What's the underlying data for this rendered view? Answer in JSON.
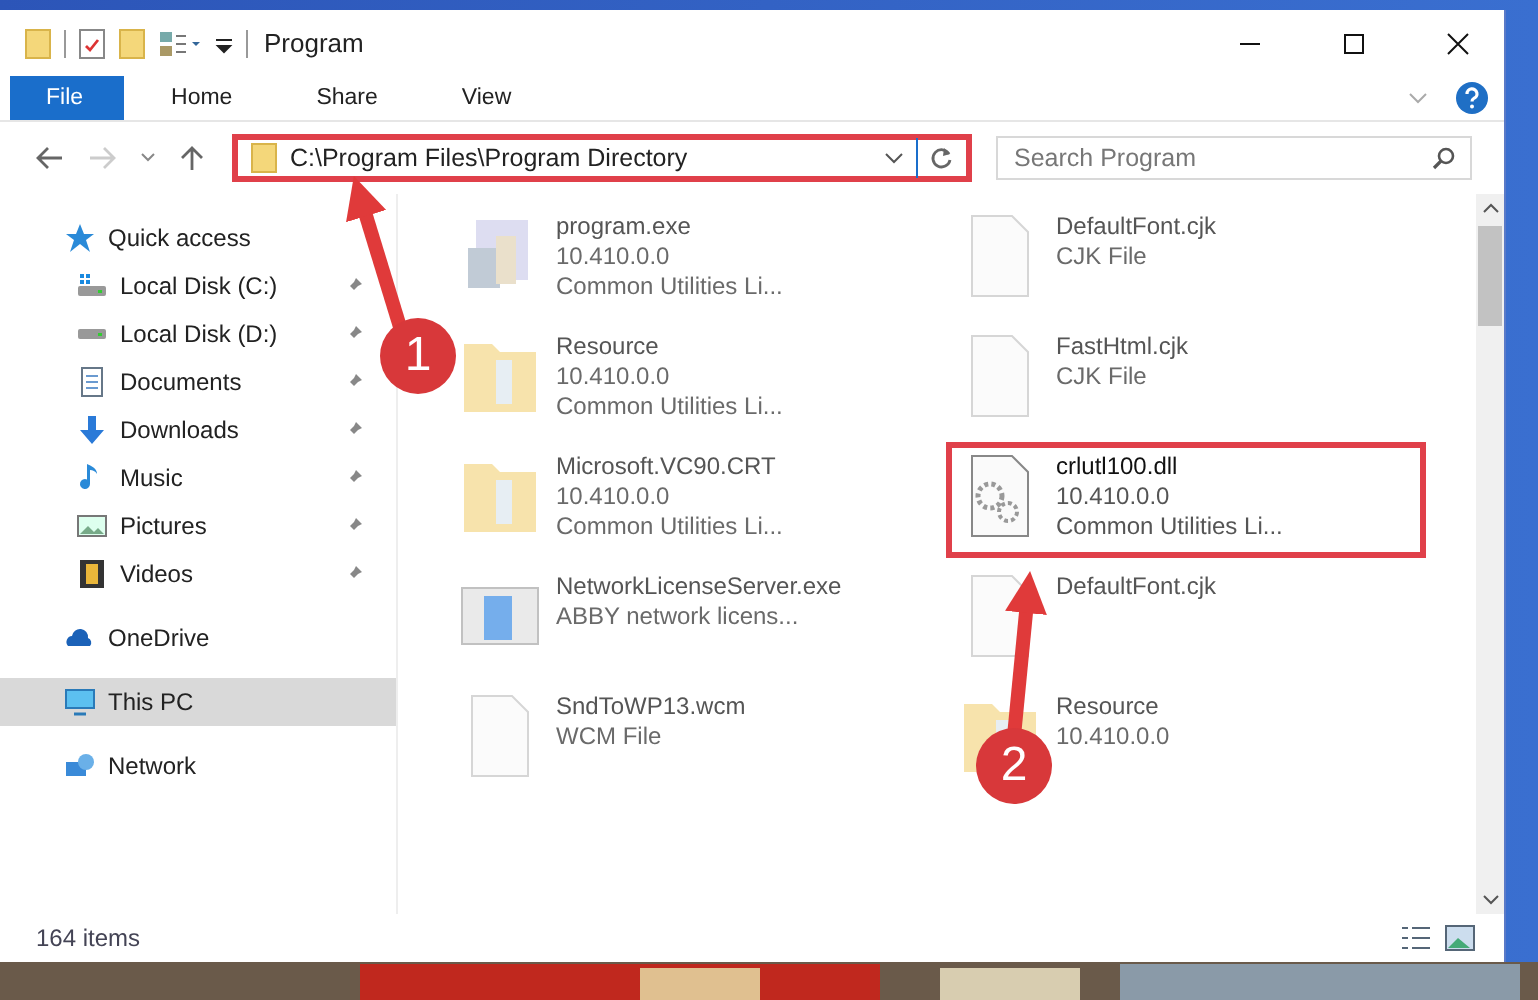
{
  "window": {
    "title": "Program"
  },
  "ribbon_tabs": [
    {
      "label": "File",
      "selected": true
    },
    {
      "label": "Home",
      "selected": false
    },
    {
      "label": "Share",
      "selected": false
    },
    {
      "label": "View",
      "selected": false
    }
  ],
  "address": {
    "path": "C:\\Program Files\\Program Directory",
    "highlighted": true
  },
  "search": {
    "placeholder": "Search Program"
  },
  "sidebar": {
    "items": [
      {
        "label": "Quick access",
        "kind": "star",
        "selected": false,
        "children": [
          {
            "label": "Local Disk (C:)",
            "kind": "disk-c",
            "selected": false,
            "pinned": true
          },
          {
            "label": "Local Disk (D:)",
            "kind": "disk",
            "selected": false,
            "pinned": true
          },
          {
            "label": "Documents",
            "kind": "documents",
            "selected": false,
            "pinned": true
          },
          {
            "label": "Downloads",
            "kind": "downloads",
            "selected": false,
            "pinned": true
          },
          {
            "label": "Music",
            "kind": "music",
            "selected": false,
            "pinned": true
          },
          {
            "label": "Pictures",
            "kind": "pictures",
            "selected": false,
            "pinned": true
          },
          {
            "label": "Videos",
            "kind": "videos",
            "selected": false,
            "pinned": true
          }
        ]
      },
      {
        "label": "OneDrive",
        "kind": "cloud",
        "selected": false
      },
      {
        "label": "This PC",
        "kind": "pc",
        "selected": true
      },
      {
        "label": "Network",
        "kind": "network",
        "selected": false
      }
    ]
  },
  "files": [
    {
      "name": "program.exe",
      "lines": [
        "10.410.0.0",
        "Common Utilities Li..."
      ],
      "kind": "exe",
      "highlighted": false,
      "faded": true
    },
    {
      "name": "DefaultFont.cjk",
      "lines": [
        "CJK File"
      ],
      "kind": "blank",
      "highlighted": false,
      "faded": true
    },
    {
      "name": "Resource",
      "lines": [
        "10.410.0.0",
        "Common Utilities Li..."
      ],
      "kind": "folder",
      "highlighted": false,
      "faded": true
    },
    {
      "name": "FastHtml.cjk",
      "lines": [
        "CJK File"
      ],
      "kind": "blank",
      "highlighted": false,
      "faded": true
    },
    {
      "name": "Microsoft.VC90.CRT",
      "lines": [
        "10.410.0.0",
        "Common Utilities Li..."
      ],
      "kind": "folder",
      "highlighted": false,
      "faded": true
    },
    {
      "name": "crlutl100.dll",
      "lines": [
        "10.410.0.0",
        "Common Utilities Li..."
      ],
      "kind": "dll",
      "highlighted": true,
      "faded": false
    },
    {
      "name": "NetworkLicenseServer.exe",
      "lines": [
        "ABBY network licens..."
      ],
      "kind": "app",
      "highlighted": false,
      "faded": true
    },
    {
      "name": "DefaultFont.cjk",
      "kind": "blank",
      "highlighted": false,
      "faded": true
    },
    {
      "name": "SndToWP13.wcm",
      "lines": [
        "WCM File"
      ],
      "kind": "blank",
      "highlighted": false,
      "faded": true
    },
    {
      "name": "Resource",
      "lines": [
        "10.410.0.0"
      ],
      "kind": "folder",
      "highlighted": false,
      "faded": true
    }
  ],
  "status_bar": {
    "count": "164 items"
  },
  "annotations": [
    {
      "label": "1"
    },
    {
      "label": "2"
    }
  ]
}
